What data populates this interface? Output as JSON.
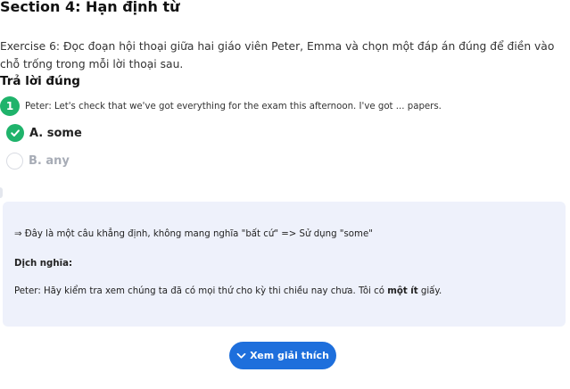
{
  "section": {
    "title": "Section 4: Hạn định từ"
  },
  "exercise": {
    "instructions": "Exercise 6: Đọc đoạn hội thoại giữa hai giáo viên Peter, Emma và chọn một đáp án đúng để điền vào chỗ trống trong mỗi lời thoại sau.",
    "answer_heading": "Trả lời đúng"
  },
  "question": {
    "number": "1",
    "text": "Peter: Let's check that we've got everything for the exam this afternoon. I've got ... papers.",
    "options": [
      {
        "label": "A. some",
        "selected": true,
        "correct": true,
        "icon": "check-icon"
      },
      {
        "label": "B. any",
        "selected": false,
        "correct": false,
        "icon": "radio-empty-icon"
      }
    ]
  },
  "explanation": {
    "reason": "⇒ Đây là một câu khẳng định, không mang nghĩa \"bất cứ\" => Sử dụng \"some\"",
    "translation_heading": "Dịch nghĩa:",
    "translation_before": "Peter: Hãy kiểm tra xem chúng ta đã có mọi thứ cho kỳ thi chiều nay chưa. Tôi có ",
    "translation_bold": "một ít",
    "translation_after": " giấy."
  },
  "button": {
    "label": "Xem giải thích",
    "icon": "chevron-down-icon"
  },
  "colors": {
    "accent_green": "#1fb36b",
    "primary_blue": "#1e6fdc",
    "panel_bg": "#eef1fb",
    "muted_text": "#a7acb6"
  }
}
